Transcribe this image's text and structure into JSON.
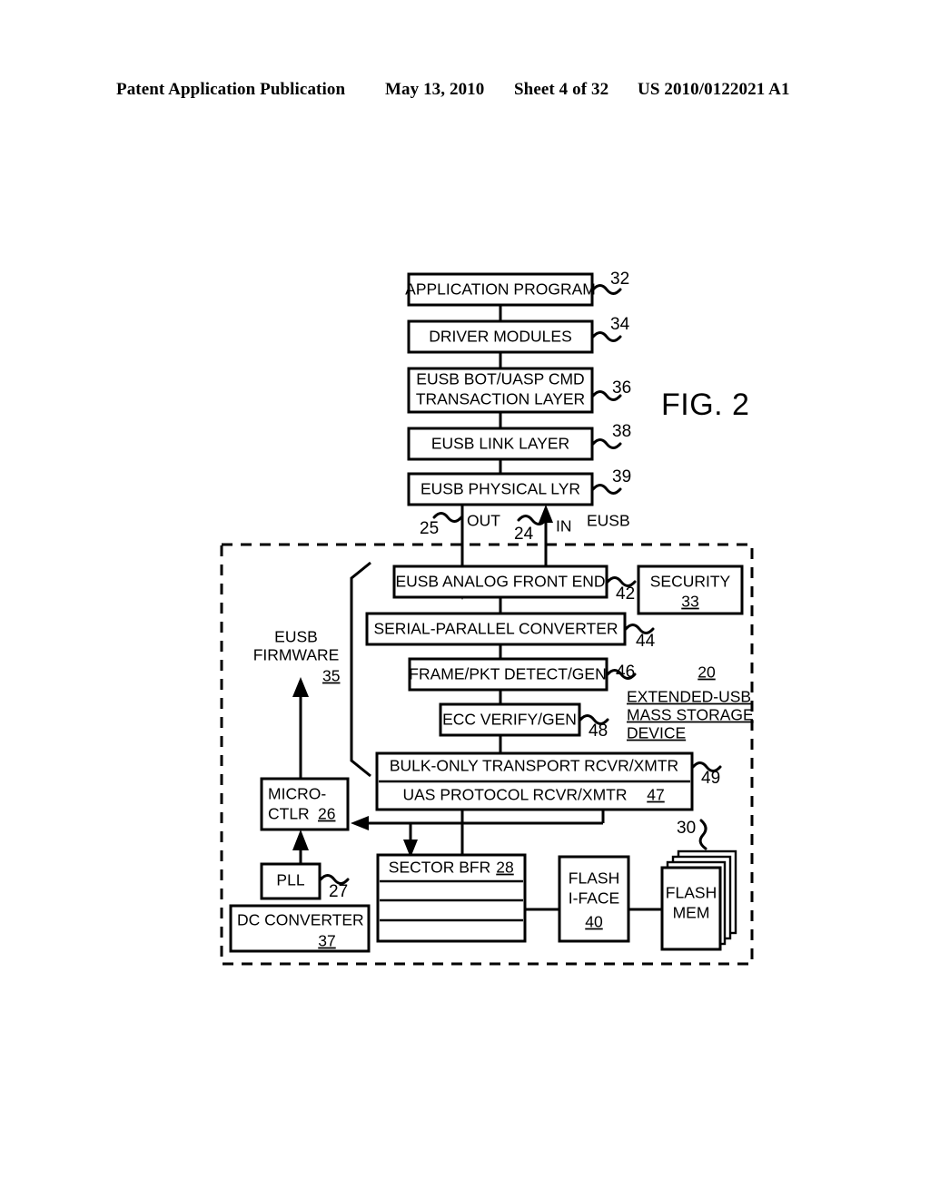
{
  "header": {
    "publication": "Patent Application Publication",
    "date": "May 13, 2010",
    "sheet": "Sheet 4 of 32",
    "patent_number": "US 2010/0122021 A1"
  },
  "figure": {
    "label": "FIG. 2",
    "title_block": {
      "ref": "20",
      "line1": "EXTENDED-USB",
      "line2": "MASS STORAGE",
      "line3": "DEVICE"
    },
    "host_stack": [
      {
        "id": "application-program",
        "label": "APPLICATION PROGRAM",
        "ref": "32"
      },
      {
        "id": "driver-modules",
        "label": "DRIVER MODULES",
        "ref": "34"
      },
      {
        "id": "transaction-layer",
        "label_line1": "EUSB BOT/UASP CMD",
        "label_line2": "TRANSACTION LAYER",
        "ref": "36"
      },
      {
        "id": "eusb-link-layer",
        "label": "EUSB LINK LAYER",
        "ref": "38"
      },
      {
        "id": "eusb-physical-lyr",
        "label": "EUSB PHYSICAL LYR",
        "ref": "39"
      }
    ],
    "bus_labels": {
      "out": "OUT",
      "out_ref": "25",
      "in": "IN",
      "in_ref": "24",
      "bus_name": "EUSB"
    },
    "device_blocks": [
      {
        "id": "eusb-analog-front-end",
        "label": "EUSB ANALOG FRONT END",
        "ref": "42"
      },
      {
        "id": "serial-parallel-converter",
        "label": "SERIAL-PARALLEL CONVERTER",
        "ref": "44"
      },
      {
        "id": "frame-pkt-detect-gen",
        "label": "FRAME/PKT DETECT/GEN",
        "ref": "46"
      },
      {
        "id": "ecc-verify-gen",
        "label": "ECC VERIFY/GEN",
        "ref": "48"
      }
    ],
    "transport": {
      "bulk_label": "BULK-ONLY TRANSPORT RCVR/XMTR",
      "bulk_ref": "49",
      "uas_label": "UAS PROTOCOL RCVR/XMTR",
      "uas_ref": "47"
    },
    "security": {
      "label": "SECURITY",
      "ref": "33"
    },
    "firmware": {
      "line1": "EUSB",
      "line2": "FIRMWARE",
      "ref": "35"
    },
    "microctlr": {
      "line1": "MICRO-",
      "line2": "CTLR",
      "ref": "26"
    },
    "pll": {
      "label": "PLL",
      "ref": "27"
    },
    "dc_converter": {
      "label": "DC CONVERTER",
      "ref": "37"
    },
    "sector_bfr": {
      "label": "SECTOR BFR",
      "ref": "28",
      "empty_rows": 3
    },
    "flash_iface": {
      "line1": "FLASH",
      "line2": "I-FACE",
      "ref": "40"
    },
    "flash_mem": {
      "line1": "FLASH",
      "line2": "MEM",
      "ref": "30",
      "stack_count": 3
    }
  },
  "colors": {
    "ink": "#000000",
    "paper": "#ffffff"
  }
}
